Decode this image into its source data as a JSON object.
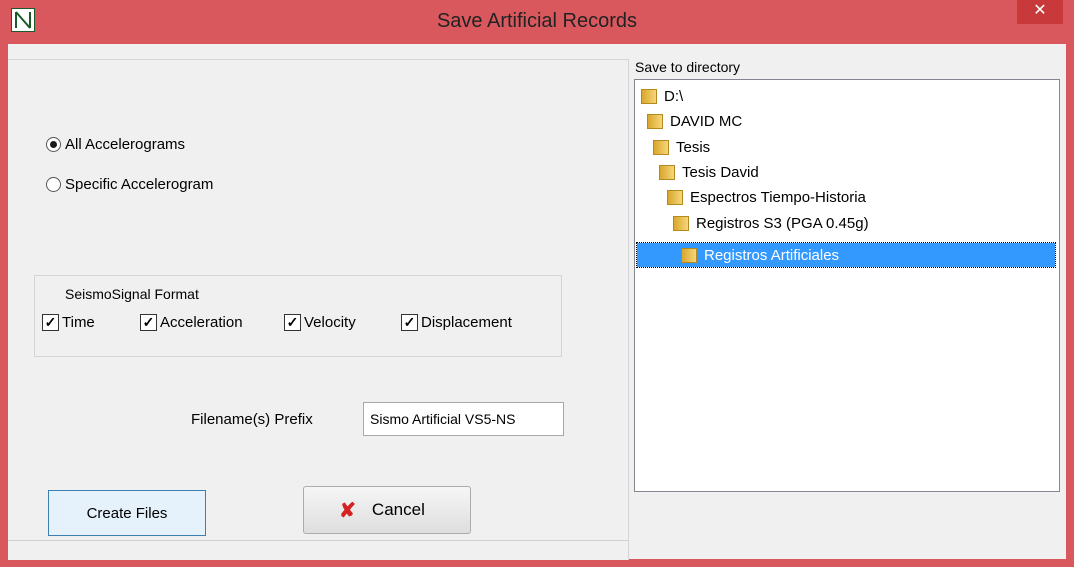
{
  "window": {
    "title": "Save Artificial Records",
    "close_label": "✕"
  },
  "options": {
    "all_label": "All  Accelerograms",
    "specific_label": "Specific Accelerogram",
    "selected": "all"
  },
  "format": {
    "title": "SeismoSignal Format",
    "time_label": "Time",
    "acceleration_label": "Acceleration",
    "velocity_label": "Velocity",
    "displacement_label": "Displacement",
    "checked": [
      true,
      true,
      true,
      true
    ]
  },
  "prefix": {
    "label": "Filename(s) Prefix",
    "value": "Sismo Artificial VS5-NS"
  },
  "buttons": {
    "create_label": "Create Files",
    "cancel_label": "Cancel"
  },
  "directory": {
    "label": "Save to directory",
    "items": [
      {
        "label": "D:\\"
      },
      {
        "label": "DAVID MC"
      },
      {
        "label": "Tesis"
      },
      {
        "label": "Tesis David"
      },
      {
        "label": "Espectros Tiempo-Historia"
      },
      {
        "label": "Registros S3 (PGA 0.45g)"
      },
      {
        "label": "Registros Artificiales",
        "selected": true
      }
    ]
  },
  "colors": {
    "titlebar": "#d9585e",
    "close_button": "#c8393c",
    "selection": "#3399ff",
    "cancel_icon": "#d42222"
  }
}
